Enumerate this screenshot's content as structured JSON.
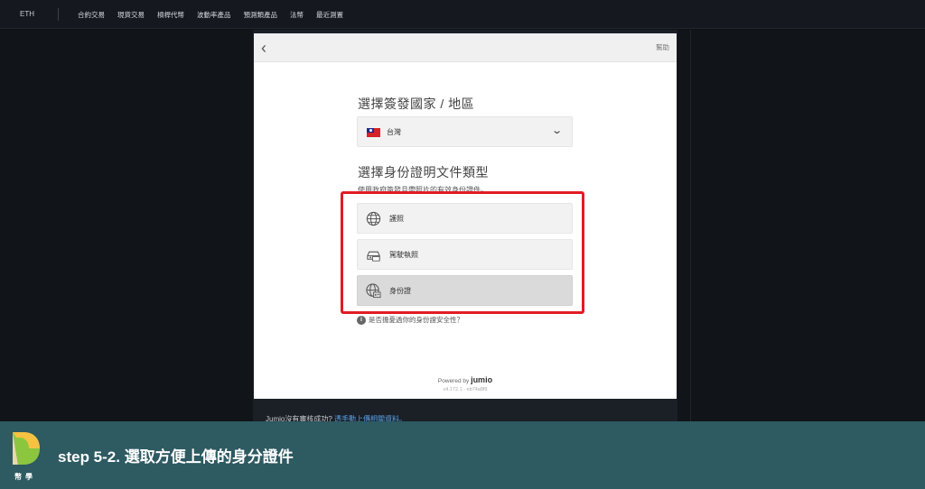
{
  "topbar": {
    "coin": "ETH",
    "nav": [
      "合約交易",
      "現貨交易",
      "槓桿代幣",
      "波動率產品",
      "預測類產品",
      "法幣",
      "最近測置"
    ]
  },
  "modal": {
    "back_icon": "chevron-left-icon",
    "help_label": "幫助",
    "country_title": "選擇簽發國家 / 地區",
    "country_value": "台灣",
    "doc_title": "選擇身份證明文件類型",
    "doc_hint": "使用政府簽發且帶照片的有效身份證件。",
    "doc_options": [
      {
        "label": "護照",
        "icon": "globe-passport-icon",
        "selected": false
      },
      {
        "label": "駕駛執照",
        "icon": "car-license-icon",
        "selected": false
      },
      {
        "label": "身份證",
        "icon": "globe-id-card-icon",
        "selected": true
      }
    ],
    "faq": "是否擔憂過你的身份證安全性？",
    "powered_by": "Powered by",
    "brand": "jumio",
    "version": "v4.172.1 - eb74a8f9"
  },
  "below": {
    "text": "Jumio沒有審核成功?",
    "link": "透手動上傳相關資料。"
  },
  "banner": {
    "logo_text": "幣學",
    "caption": "step 5-2. 選取方便上傳的身分證件",
    "color": "#2e5a62",
    "highlight_color": "#e11c24"
  }
}
